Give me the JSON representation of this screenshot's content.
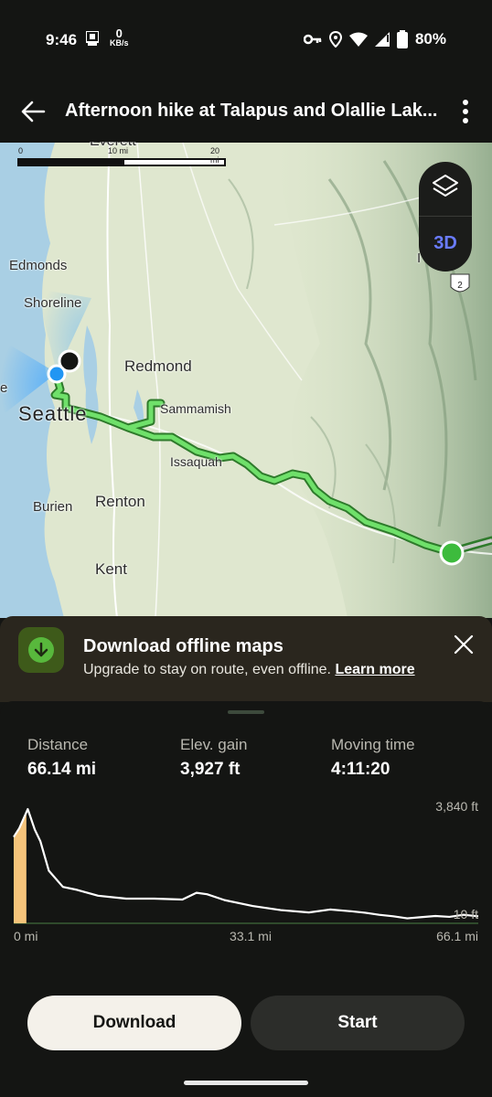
{
  "status_bar": {
    "time": "9:46",
    "net_speed_value": "0",
    "net_speed_unit": "KB/s",
    "battery": "80%"
  },
  "header": {
    "title": "Afternoon hike at Talapus and Olallie Lak..."
  },
  "map": {
    "scale_start": "0",
    "scale_mid": "10 mi",
    "scale_end": "20 mi",
    "partial_top_label": "Everett",
    "labels": {
      "edmonds": "Edmonds",
      "shoreline": "Shoreline",
      "redmond": "Redmond",
      "seattle": "Seattle",
      "sammamish": "Sammamish",
      "issaquah": "Issaquah",
      "burien": "Burien",
      "renton": "Renton",
      "kent": "Kent",
      "edge_left": "e",
      "edge_right": "I"
    },
    "highway_shield": "2",
    "layers_icon": "layers-icon",
    "three_d_label": "3D"
  },
  "banner": {
    "title": "Download offline maps",
    "subtitle": "Upgrade to stay on route, even offline.",
    "link": "Learn more"
  },
  "stats": [
    {
      "label": "Distance",
      "value": "66.14 mi"
    },
    {
      "label": "Elev. gain",
      "value": "3,927 ft"
    },
    {
      "label": "Moving time",
      "value": "4:11:20"
    }
  ],
  "chart_data": {
    "type": "area",
    "x_ticks": [
      "0 mi",
      "33.1 mi",
      "66.1 mi"
    ],
    "y_ticks": [
      "3,840 ft",
      "10 ft"
    ],
    "xlim": [
      0,
      66.1
    ],
    "ylim": [
      10,
      3840
    ],
    "x": [
      0,
      0.8,
      2,
      3,
      3.8,
      5,
      7,
      9,
      12,
      16,
      20,
      24,
      26,
      27.5,
      30,
      34,
      38,
      42,
      45,
      48,
      50,
      52,
      54,
      56,
      58,
      60,
      62,
      64,
      66.1
    ],
    "y": [
      2950,
      3250,
      3900,
      3200,
      2800,
      1800,
      1250,
      1150,
      950,
      850,
      850,
      820,
      1050,
      1000,
      800,
      600,
      460,
      380,
      480,
      420,
      370,
      300,
      250,
      180,
      220,
      260,
      230,
      300,
      250
    ],
    "highlight_range": [
      0,
      1.8
    ],
    "colors": {
      "line": "#ffffff",
      "highlight": "#f6c47a"
    }
  },
  "buttons": {
    "download": "Download",
    "start": "Start"
  }
}
